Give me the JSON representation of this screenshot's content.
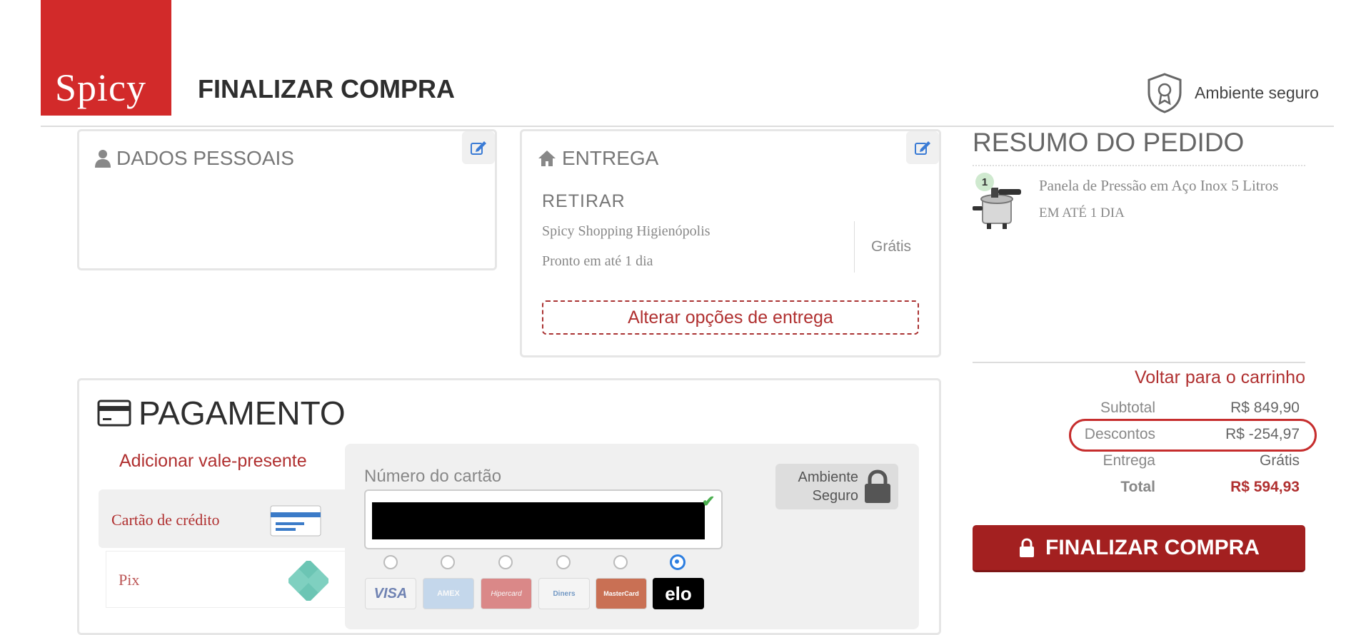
{
  "header": {
    "logo_text": "Spicy",
    "title": "FINALIZAR COMPRA",
    "secure_label": "Ambiente seguro"
  },
  "personal": {
    "title": "DADOS PESSOAIS"
  },
  "delivery": {
    "title": "ENTREGA",
    "mode": "RETIRAR",
    "store": "Spicy Shopping Higienópolis",
    "ready": "Pronto em até 1 dia",
    "price": "Grátis",
    "change_button": "Alterar opções de entrega"
  },
  "summary": {
    "title": "RESUMO DO PEDIDO",
    "item": {
      "quantity": "1",
      "name": "Panela de Pressão em Aço Inox 5 Litros",
      "shipping": "EM ATÉ 1 DIA"
    },
    "back_to_cart": "Voltar para o carrinho",
    "rows": [
      {
        "label": "Subtotal",
        "value": "R$ 849,90"
      },
      {
        "label": "Descontos",
        "value": "R$ -254,97"
      },
      {
        "label": "Entrega",
        "value": "Grátis"
      },
      {
        "label": "Total",
        "value": "R$ 594,93"
      }
    ],
    "finalize_button": "FINALIZAR COMPRA"
  },
  "payment": {
    "title": "PAGAMENTO",
    "gift_card": "Adicionar vale-presente",
    "methods": [
      {
        "label": "Cartão de crédito",
        "icon": "credit-card-icon"
      },
      {
        "label": "Pix",
        "icon": "pix-icon"
      }
    ],
    "card_number_label": "Número do cartão",
    "secure_badge_line1": "Ambiente",
    "secure_badge_line2": "Seguro",
    "brands": [
      "VISA",
      "AMEX",
      "Hipercard",
      "Diners",
      "MasterCard",
      "elo"
    ],
    "selected_brand": "elo"
  },
  "colors": {
    "brand_red": "#d22a2a",
    "accent_red": "#b03030",
    "button_red": "#a32020"
  }
}
